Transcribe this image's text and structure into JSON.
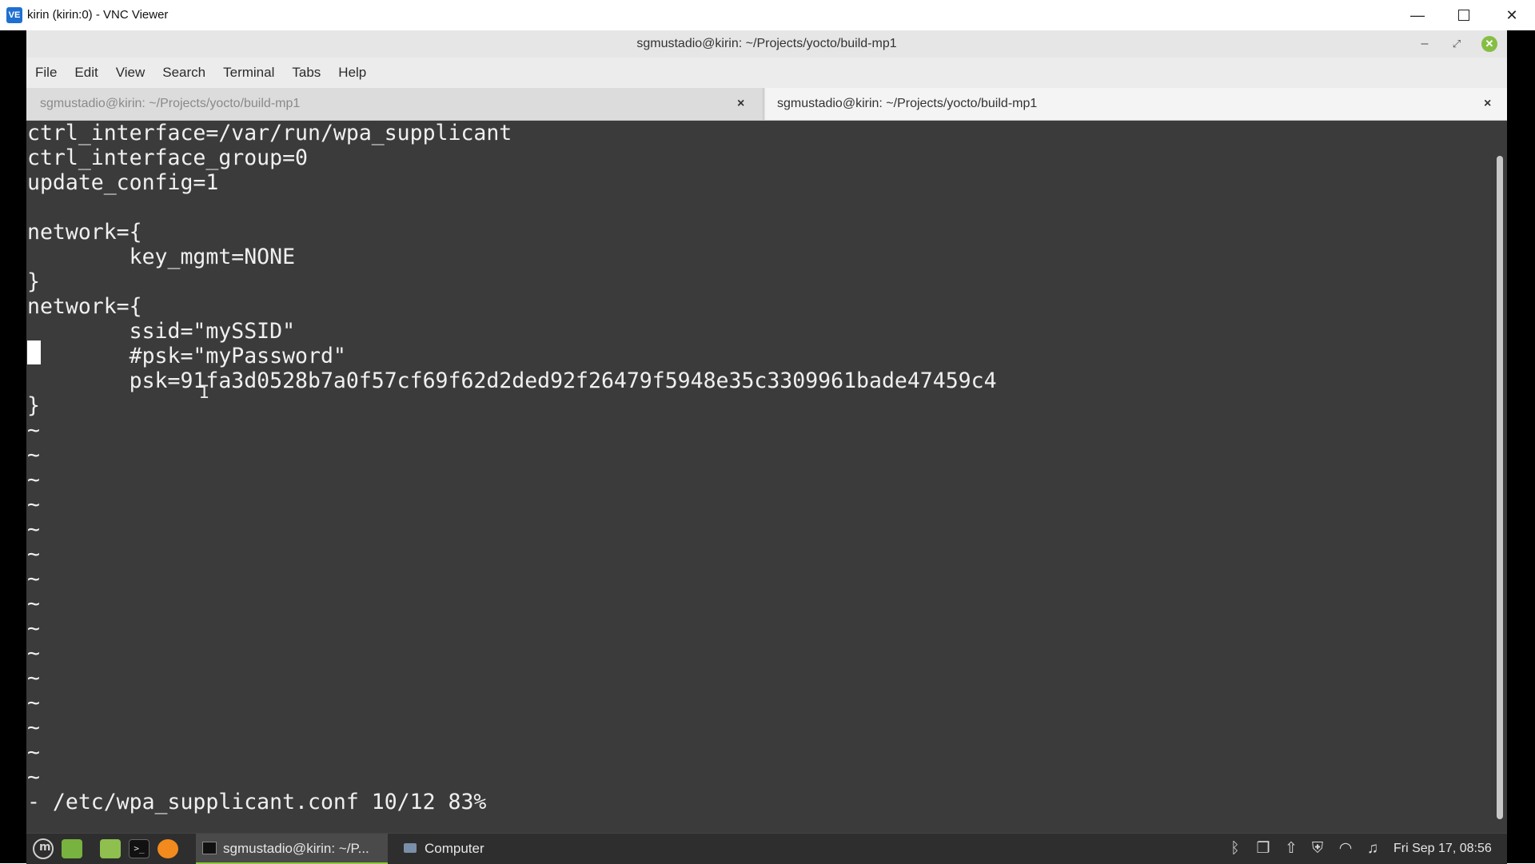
{
  "vnc": {
    "app_icon_text": "VE",
    "title": "kirin (kirin:0) - VNC Viewer",
    "minimize": "—",
    "close": "✕"
  },
  "terminal": {
    "title": "sgmustadio@kirin: ~/Projects/yocto/build-mp1",
    "minimize": "–",
    "restore": "⤢",
    "close": "✕",
    "menu": [
      "File",
      "Edit",
      "View",
      "Search",
      "Terminal",
      "Tabs",
      "Help"
    ],
    "tabs": [
      {
        "label": "sgmustadio@kirin: ~/Projects/yocto/build-mp1",
        "close": "×",
        "active": false
      },
      {
        "label": "sgmustadio@kirin: ~/Projects/yocto/build-mp1",
        "close": "×",
        "active": true
      }
    ],
    "lines": [
      "ctrl_interface=/var/run/wpa_supplicant",
      "ctrl_interface_group=0",
      "update_config=1",
      "",
      "network={",
      "        key_mgmt=NONE",
      "}",
      "network={",
      "        ssid=\"mySSID\"",
      "        #psk=\"myPassword\"",
      "        psk=91fa3d0528b7a0f57cf69f62d2ded92f26479f5948e35c3309961bade47459c4",
      "}",
      "~",
      "~",
      "~",
      "~",
      "~",
      "~",
      "~",
      "~",
      "~",
      "~",
      "~",
      "~",
      "~",
      "~",
      "~",
      "- /etc/wpa_supplicant.conf 10/12 83%"
    ],
    "ibeam": "I"
  },
  "taskbar": {
    "terminal_icon_text": ">_",
    "task_terminal": "sgmustadio@kirin: ~/P...",
    "task_computer": "Computer",
    "tray": {
      "bluetooth": "ᛒ",
      "clipboard": "❐",
      "update": "⇧",
      "shield": "⛨",
      "wifi": "◠",
      "volume": "♫"
    },
    "clock": "Fri Sep 17, 08:56"
  },
  "colors": {
    "terminal_bg": "#3b3b3b",
    "terminal_fg": "#f0f0f0",
    "mint_green": "#86be43",
    "taskbar_bg": "#2e2e2e"
  }
}
